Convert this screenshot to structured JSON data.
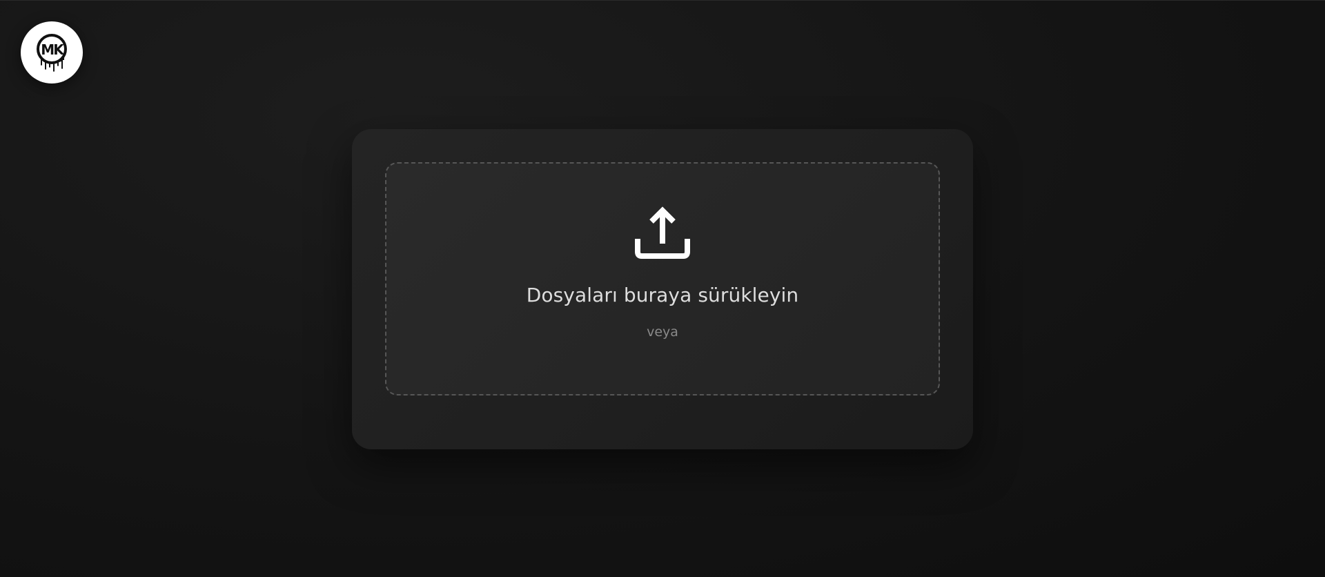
{
  "logo": {
    "icon": "mk-drip-logo-icon",
    "text": "MK"
  },
  "upload": {
    "icon": "upload-icon",
    "title": "Dosyaları buraya sürükleyin",
    "or_text": "veya"
  },
  "colors": {
    "background": "#141414",
    "card": "#202020",
    "dropzone": "#272727",
    "dashed_border": "#575757",
    "title_text": "#dedede",
    "muted_text": "#8a8a8a",
    "icon": "#ffffff"
  }
}
